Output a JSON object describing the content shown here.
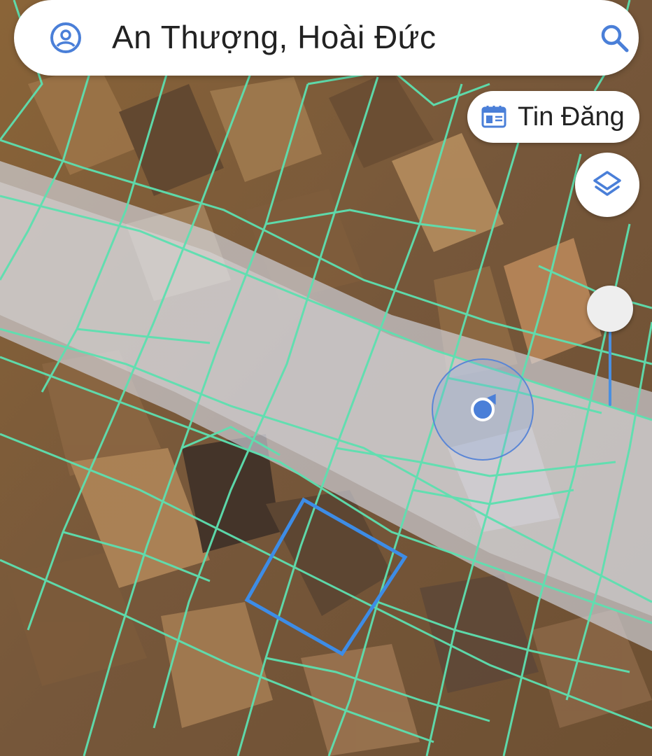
{
  "search": {
    "query": "An Thượng, Hoài Đức",
    "avatar_icon": "user-circle-icon",
    "search_icon": "search-icon"
  },
  "tin_dang": {
    "label": "Tin Đăng",
    "icon": "news-listing-icon"
  },
  "layers": {
    "icon": "layers-icon"
  },
  "opacity_slider": {
    "level": 0.0
  },
  "colors": {
    "parcel_line": "#5de0b0",
    "selected_parcel": "#3d8ce6",
    "accent": "#4a7fd8",
    "road": "#d8dde8"
  }
}
